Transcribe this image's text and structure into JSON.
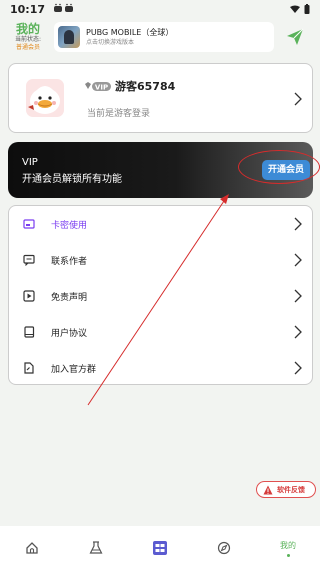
{
  "status_bar": {
    "time": "10:17"
  },
  "header": {
    "title": "我的",
    "status_text": "当前状态:",
    "level_text": "普通会员"
  },
  "game": {
    "name": "PUBG MOBILE（全球）",
    "subtitle": "点击切换游戏版本"
  },
  "profile": {
    "username": "游客65784",
    "login_hint": "当前是游客登录",
    "vip_badge": "VIP"
  },
  "vip_banner": {
    "title": "VIP",
    "subtitle": "开通会员解锁所有功能",
    "button": "开通会员"
  },
  "menu": [
    {
      "label": "卡密使用",
      "icon": "card-icon",
      "active": true
    },
    {
      "label": "联系作者",
      "icon": "chat-icon",
      "active": false
    },
    {
      "label": "免责声明",
      "icon": "play-icon",
      "active": false
    },
    {
      "label": "用户协议",
      "icon": "book-icon",
      "active": false
    },
    {
      "label": "加入官方群",
      "icon": "group-icon",
      "active": false
    }
  ],
  "feedback": {
    "label": "软件反馈"
  },
  "nav": {
    "tabs": [
      {
        "name": "home-icon"
      },
      {
        "name": "flask-icon"
      },
      {
        "name": "grid-icon"
      },
      {
        "name": "compass-icon"
      },
      {
        "name": "mine",
        "label": "我的"
      }
    ]
  },
  "colors": {
    "accent_green": "#5ab25a",
    "vip_button": "#3d8bd6",
    "active_menu": "#7a3df0",
    "annotation_red": "#d62c2c"
  }
}
